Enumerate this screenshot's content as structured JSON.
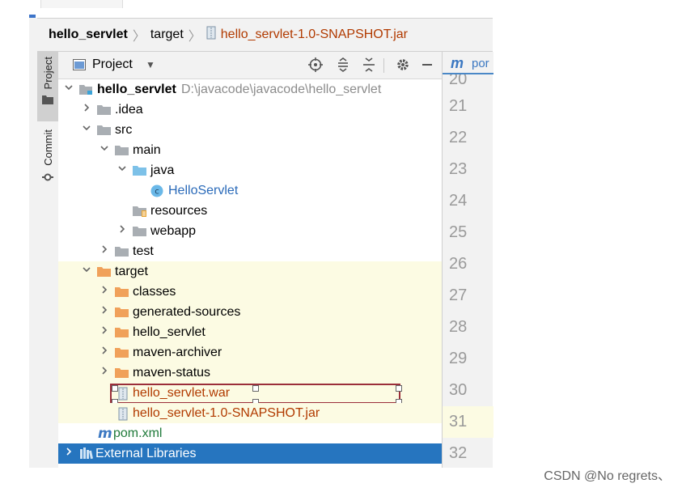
{
  "breadcrumb": {
    "root": "hello_servlet",
    "mid": "target",
    "leaf": "hello_servlet-1.0-SNAPSHOT.jar"
  },
  "sidebar": {
    "project_tab": "Project",
    "commit_tab": "Commit"
  },
  "project_panel": {
    "title": "Project",
    "toolbar_icons": [
      "locate-icon",
      "expand-all-icon",
      "collapse-all-icon",
      "gear-icon",
      "minimize-icon"
    ]
  },
  "tree": [
    {
      "label": "hello_servlet",
      "path": "D:\\javacode\\javacode\\hello_servlet",
      "icon": "module-folder",
      "indent": 0,
      "arrow": "down"
    },
    {
      "label": ".idea",
      "icon": "folder-gray",
      "indent": 1,
      "arrow": "right"
    },
    {
      "label": "src",
      "icon": "folder-gray",
      "indent": 1,
      "arrow": "down"
    },
    {
      "label": "main",
      "icon": "folder-gray",
      "indent": 2,
      "arrow": "down"
    },
    {
      "label": "java",
      "icon": "folder-blue",
      "indent": 3,
      "arrow": "down"
    },
    {
      "label": "HelloServlet",
      "icon": "class-icon",
      "indent": 4,
      "arrow": "none"
    },
    {
      "label": "resources",
      "icon": "resources-folder",
      "indent": 3,
      "arrow": "none"
    },
    {
      "label": "webapp",
      "icon": "folder-gray",
      "indent": 3,
      "arrow": "right"
    },
    {
      "label": "test",
      "icon": "folder-gray",
      "indent": 2,
      "arrow": "right"
    },
    {
      "label": "target",
      "icon": "folder-orange",
      "indent": 1,
      "arrow": "down"
    },
    {
      "label": "classes",
      "icon": "folder-orange",
      "indent": 2,
      "arrow": "right"
    },
    {
      "label": "generated-sources",
      "icon": "folder-orange",
      "indent": 2,
      "arrow": "right"
    },
    {
      "label": "hello_servlet",
      "icon": "folder-orange",
      "indent": 2,
      "arrow": "right"
    },
    {
      "label": "maven-archiver",
      "icon": "folder-orange",
      "indent": 2,
      "arrow": "right"
    },
    {
      "label": "maven-status",
      "icon": "folder-orange",
      "indent": 2,
      "arrow": "right"
    },
    {
      "label": "hello_servlet.war",
      "icon": "archive-icon",
      "indent": 2,
      "arrow": "none"
    },
    {
      "label": "hello_servlet-1.0-SNAPSHOT.jar",
      "icon": "archive-icon",
      "indent": 2,
      "arrow": "none"
    },
    {
      "label": "pom.xml",
      "icon": "maven-icon",
      "indent": 1,
      "arrow": "none"
    },
    {
      "label": "External Libraries",
      "icon": "libraries-icon",
      "indent": 0,
      "arrow": "right"
    }
  ],
  "editor": {
    "tab_label": "por",
    "line_numbers": [
      "20",
      "21",
      "22",
      "23",
      "24",
      "25",
      "26",
      "27",
      "28",
      "29",
      "30",
      "31",
      "32"
    ],
    "current_line": "31"
  },
  "watermark": "CSDN @No regrets、",
  "colors": {
    "selection": "#2675bf",
    "excluded_bg": "#fcfbe3",
    "folder_orange": "#f0a15a",
    "folder_gray": "#a9aeb3",
    "folder_blue": "#7dc1e8",
    "jar_text": "#b13a00",
    "link_blue": "#2a6ab9",
    "highlight_box": "#9b2e3a"
  }
}
